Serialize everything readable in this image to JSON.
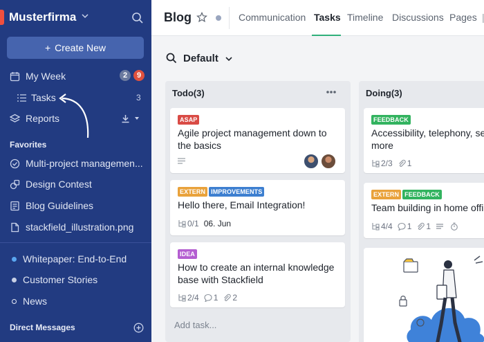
{
  "sidebar": {
    "company": "Musterfirma",
    "create_new": "Create New",
    "my_week": "My Week",
    "my_week_badges": [
      "2",
      "9"
    ],
    "tasks": "Tasks",
    "tasks_count": "3",
    "reports": "Reports",
    "favorites_title": "Favorites",
    "favorites": [
      "Multi-project managemen...",
      "Design Contest",
      "Blog Guidelines",
      "stackfield_illustration.png"
    ],
    "rooms": [
      {
        "label": "Whitepaper: End-to-End",
        "dot_color": "#5aa6f0"
      },
      {
        "label": "Customer Stories",
        "dot_color": "#c7cfe4"
      },
      {
        "label": "News",
        "dot_color": "#ffffff"
      }
    ],
    "direct_messages": "Direct Messages"
  },
  "header": {
    "title": "Blog",
    "tabs": [
      "Communication",
      "Tasks",
      "Timeline",
      "Discussions",
      "Pages"
    ],
    "active_tab": "Tasks"
  },
  "board": {
    "name": "Default",
    "columns": [
      {
        "title": "Todo(3)",
        "cards": [
          {
            "tags": [
              {
                "text": "ASAP",
                "color": "#d94b45"
              }
            ],
            "title": "Agile project management down to the basics"
          },
          {
            "tags": [
              {
                "text": "EXTERN",
                "color": "#e9a23b"
              },
              {
                "text": "IMPROVEMENTS",
                "color": "#3d7fd0"
              }
            ],
            "title": "Hello there, Email Integration!",
            "subtasks": "0/1",
            "due": "06. Jun"
          },
          {
            "tags": [
              {
                "text": "IDEA",
                "color": "#b45ed1"
              }
            ],
            "title": "How to create an internal knowledge base with Stackfield",
            "subtasks": "2/4",
            "comments": "1",
            "attachments": "2"
          }
        ],
        "add_task": "Add task..."
      },
      {
        "title": "Doing(3)",
        "cards": [
          {
            "tags": [
              {
                "text": "FEEDBACK",
                "color": "#32b35f"
              }
            ],
            "title_line1": "Accessibility, telephony, sea",
            "title_line2": "more",
            "subtasks": "2/3",
            "attachments": "1"
          },
          {
            "tags": [
              {
                "text": "EXTERN",
                "color": "#e9a23b"
              },
              {
                "text": "FEEDBACK",
                "color": "#32b35f"
              }
            ],
            "title": "Team building in home offic",
            "subtasks": "4/4",
            "comments": "1",
            "attachments": "1"
          }
        ]
      }
    ]
  },
  "colors": {
    "sidebar": "#223b81",
    "accent": "#2fb07a",
    "badge_gray": "#6b7a9f",
    "badge_red": "#e0513e"
  }
}
